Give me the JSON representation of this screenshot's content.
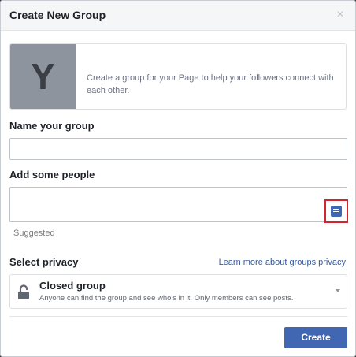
{
  "dialog": {
    "title": "Create New Group",
    "close_icon": "close-icon"
  },
  "intro": {
    "avatar_letter": "Y",
    "text": "Create a group for your Page to help your followers connect with each other."
  },
  "name_field": {
    "label": "Name your group",
    "value": "",
    "placeholder": ""
  },
  "people_field": {
    "label": "Add some people",
    "value": "",
    "placeholder": "",
    "action_icon": "message-note-icon",
    "suggested_label": "Suggested"
  },
  "privacy": {
    "label": "Select privacy",
    "learn_more": "Learn more about groups privacy",
    "selected_title": "Closed group",
    "selected_desc": "Anyone can find the group and see who's in it. Only members can see posts.",
    "icon": "lock-icon"
  },
  "footer": {
    "create_label": "Create"
  },
  "colors": {
    "accent": "#4267b2",
    "link": "#365899",
    "highlight_box": "#d1262d"
  }
}
